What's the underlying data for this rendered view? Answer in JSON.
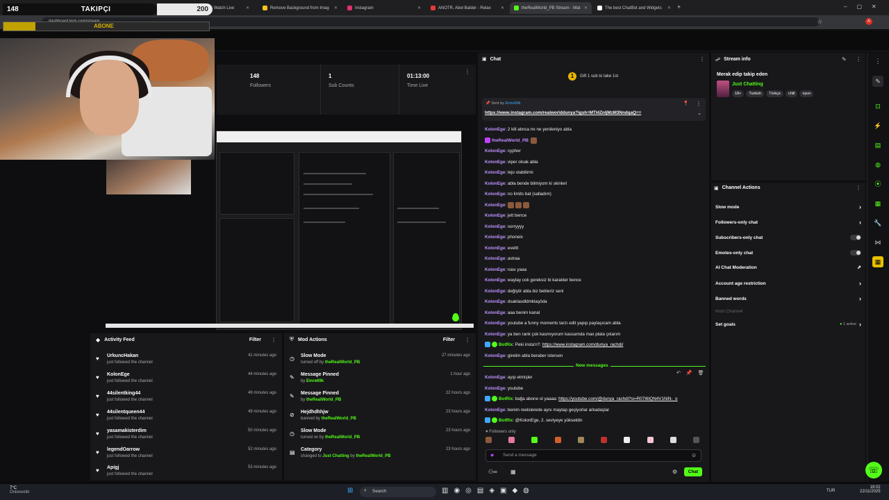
{
  "browser": {
    "tabs": [
      {
        "label": "Kick | Stream - Watch Live",
        "color": "#53fc18"
      },
      {
        "label": "Remove Background from Imag",
        "color": "#f5c518"
      },
      {
        "label": "Instagram",
        "color": "#e1306c"
      },
      {
        "label": "ANOTR, Abel Balder - Relax",
        "color": "#e53935"
      },
      {
        "label": "theRealWorld_PB Stream - Wat",
        "color": "#53fc18"
      },
      {
        "label": "The best ChatBot and Widgets",
        "color": "#ffffff"
      }
    ],
    "address": "dashboard.kick.com/stream"
  },
  "overlay": {
    "follower_count": "148",
    "follower_label": "TAKIPÇI",
    "goal": "200",
    "sub_label": "ABONE"
  },
  "stats": [
    {
      "value": "148",
      "label": "Followers"
    },
    {
      "value": "1",
      "label": "Sub Counts"
    },
    {
      "value": "01:13:00",
      "label": "Time Live"
    }
  ],
  "activity": {
    "title": "Activity Feed",
    "filter": "Filter",
    "items": [
      {
        "name": "UrkuncHakan",
        "sub": "just followed the channel",
        "time": "41 minutes ago"
      },
      {
        "name": "KolonEge",
        "sub": "just followed the channel",
        "time": "44 minutes ago"
      },
      {
        "name": "44silentking44",
        "sub": "just followed the channel",
        "time": "49 minutes ago"
      },
      {
        "name": "44silentqueen44",
        "sub": "just followed the channel",
        "time": "49 minutes ago"
      },
      {
        "name": "yasamakisterdim",
        "sub": "just followed the channel",
        "time": "50 minutes ago"
      },
      {
        "name": "legendOarrow",
        "sub": "just followed the channel",
        "time": "52 minutes ago"
      },
      {
        "name": "Apigj",
        "sub": "just followed the channel",
        "time": "53 minutes ago"
      }
    ]
  },
  "mod": {
    "title": "Mod Actions",
    "filter": "Filter",
    "items": [
      {
        "name": "Slow Mode",
        "pre": "turned off by",
        "by": "theRealWorld_PB",
        "time": "27 minutes ago"
      },
      {
        "name": "Message Pinned",
        "pre": "by",
        "by": "Emre69k",
        "time": "1 hour ago"
      },
      {
        "name": "Message Pinned",
        "pre": "by",
        "by": "theRealWorld_PB",
        "time": "22 hours ago"
      },
      {
        "name": "Hejdhdhhjw",
        "pre": "banned by",
        "by": "theRealWorld_PB",
        "time": "23 hours ago"
      },
      {
        "name": "Slow Mode",
        "pre": "turned on by",
        "by": "theRealWorld_PB",
        "time": "23 hours ago"
      },
      {
        "name": "Category",
        "pre": "changed to",
        "by": "Just Chatting",
        "post": "by",
        "by2": "theRealWorld_PB",
        "time": "23 hours ago"
      }
    ]
  },
  "chat": {
    "title": "Chat",
    "gift": "Gift 1 sub to take 1st",
    "pinned_by_label": "Sent by",
    "pinned_by": "Emre69k",
    "pinned_link": "https://www.instagram.com/realworlddunya?igsh=MTI4ZnljMzM3NndqaQ==",
    "messages": [
      {
        "user": "KolonEge",
        "text": "2 kill alınca mı ne yenileniyo abla"
      },
      {
        "user": "theRealWorld_PB",
        "text": ""
      },
      {
        "user": "KolonEge",
        "text": "cypher"
      },
      {
        "user": "KolonEge",
        "text": "viper olcak abla"
      },
      {
        "user": "KolonEge",
        "text": "tejo olabilirmi"
      },
      {
        "user": "KolonEge",
        "text": "abla bende bilmiyom ki skinleri"
      },
      {
        "user": "KolonEge",
        "text": "no limits bat (salladım)"
      },
      {
        "user": "KolonEge",
        "text": ""
      },
      {
        "user": "KolonEge",
        "text": "jett bence"
      },
      {
        "user": "KolonEge",
        "text": "sorryyyy"
      },
      {
        "user": "KolonEge",
        "text": "phoneix"
      },
      {
        "user": "KolonEge",
        "text": "evettt"
      },
      {
        "user": "KolonEge",
        "text": "astraa"
      },
      {
        "user": "KolonEge",
        "text": "nası yaaa"
      },
      {
        "user": "KolonEge",
        "text": "waylay cok gereksiz bi karakter bence"
      },
      {
        "user": "KolonEge",
        "text": "değiştir abla biz bekleriz seni"
      },
      {
        "user": "KolonEge",
        "text": "dsaklasdldmklaşöda"
      },
      {
        "user": "KolonEge",
        "text": "aaa benim kanal"
      },
      {
        "user": "KolonEge",
        "text": "youtube a funny moments tarzı edit yapıp paylaşıcam abla"
      },
      {
        "user": "KolonEge",
        "text": "ya ben rank çok kasmıyorum kassamda max plata çıkarım"
      },
      {
        "user": "BotRix",
        "text": "Peki insta'n?: ",
        "link": "https://www.instagram.com/dunya_rachdi/"
      },
      {
        "user": "KolonEge",
        "text": "girelim abla beraber istersen"
      }
    ],
    "new_messages_label": "New messages",
    "new": [
      {
        "user": "KolonEge",
        "text": "ayıp etmişler"
      },
      {
        "user": "KolonEge",
        "text": "youtube"
      },
      {
        "user": "BotRix",
        "text": "bağa abone ol yaaaa: ",
        "link": "https://youtube.com/@dunya_rachdi?si=R07I6IQN4V1NiN-_o"
      },
      {
        "user": "KolonEge",
        "text": "benim reelslerede aynı maytap geçiyorlar arkadaşlar"
      },
      {
        "user": "BotRix",
        "text": "@KolonEge, 2. seviyeye yükseldin"
      }
    ],
    "followers_only": "Followers only",
    "placeholder": "Send a message",
    "send": "Chat"
  },
  "stream_info": {
    "title": "Stream info",
    "stream_title": "Merak edip takip eden",
    "category": "Just Chatting",
    "tags": [
      "18+",
      "Turkish",
      "Türkçe",
      "chill",
      "oyun"
    ]
  },
  "channel_actions": {
    "title": "Channel Actions",
    "items": [
      {
        "label": "Slow mode",
        "kind": "arrow"
      },
      {
        "label": "Followers-only chat",
        "kind": "arrow"
      },
      {
        "label": "Subscribers-only chat",
        "kind": "toggle"
      },
      {
        "label": "Emotes-only chat",
        "kind": "toggle"
      },
      {
        "label": "AI Chat Moderation",
        "kind": "ext"
      },
      {
        "label": "Account age restriction",
        "kind": "arrow"
      },
      {
        "label": "Banned words",
        "kind": "arrow"
      },
      {
        "label": "Host Channel",
        "kind": "none"
      },
      {
        "label": "Set goals",
        "kind": "active",
        "extra": "1 active"
      }
    ]
  },
  "taskbar": {
    "weather": "7°C",
    "weather_sub": "Önbewolkt",
    "search": "Search",
    "lang": "TUR",
    "time": "19:02",
    "date": "22/11/2025"
  },
  "colors": {
    "accent": "#53fc18",
    "panel": "#18181b",
    "user": "#bf94ff"
  }
}
